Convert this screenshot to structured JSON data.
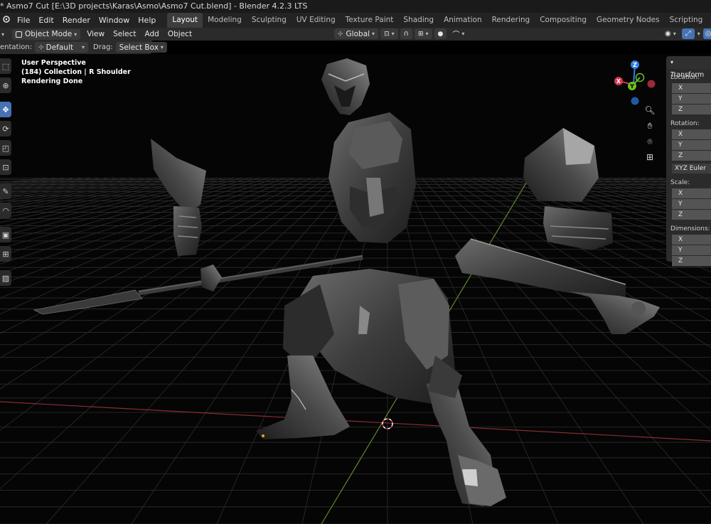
{
  "window": {
    "title": "* Asmo7 Cut [E:\\3D projects\\Karas\\Asmo\\Asmo7 Cut.blend] - Blender 4.2.3 LTS"
  },
  "menu": [
    "File",
    "Edit",
    "Render",
    "Window",
    "Help"
  ],
  "workspaces": {
    "tabs": [
      "Layout",
      "Modeling",
      "Sculpting",
      "UV Editing",
      "Texture Paint",
      "Shading",
      "Animation",
      "Rendering",
      "Compositing",
      "Geometry Nodes",
      "Scripting"
    ],
    "active": "Layout",
    "add_label": "+"
  },
  "viewport_header": {
    "mode": "Object Mode",
    "menus": [
      "View",
      "Select",
      "Add",
      "Object"
    ],
    "transform_orientation": "Global"
  },
  "tool_settings": {
    "orientation_label": "entation:",
    "orientation_value": "Default",
    "drag_label": "Drag:",
    "drag_value": "Select Box"
  },
  "overlay": {
    "view_name": "User Perspective",
    "collection": "(184) Collection | R Shoulder",
    "status": "Rendering Done"
  },
  "gizmo": {
    "z": "Z",
    "x": "X",
    "y": "Y",
    "colors": {
      "x": "#d8364b",
      "y": "#6fbf22",
      "z": "#2f7fdf"
    }
  },
  "npanel": {
    "title": "Transform",
    "location_label": "Location:",
    "rotation_label": "Rotation:",
    "rotation_mode": "XYZ Euler",
    "scale_label": "Scale:",
    "dimensions_label": "Dimensions:",
    "axes": [
      "X",
      "Y",
      "Z"
    ]
  },
  "colors": {
    "accent": "#4772b3",
    "viewport_bg": "#050505",
    "x_axis_line": "#8a2a36",
    "y_axis_line": "#5e8a2a"
  }
}
